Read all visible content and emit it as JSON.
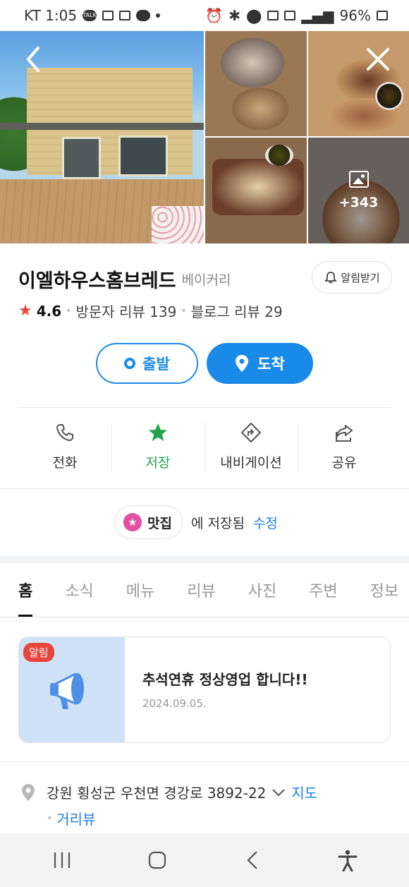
{
  "status_bar": {
    "carrier_time": "KT 1:05",
    "talk_badge": "TALK",
    "battery": "96%",
    "icons": [
      "talk-icon",
      "notification-icon",
      "photo-icon",
      "call-icon",
      "alarm-icon",
      "bluetooth-icon",
      "location-icon",
      "hd-icon",
      "5g-icon",
      "signal-icon",
      "battery-icon"
    ]
  },
  "gallery": {
    "more_count": "+343"
  },
  "place": {
    "name": "이엘하우스홈브레드",
    "category": "베이커리",
    "alert_label": "알림받기",
    "rating": "4.6",
    "visitor_reviews": "방문자 리뷰 139",
    "blog_reviews": "블로그 리뷰 29"
  },
  "route": {
    "depart_label": "출발",
    "arrive_label": "도착"
  },
  "actions": [
    {
      "label": "전화",
      "icon": "phone-icon"
    },
    {
      "label": "저장",
      "icon": "star-icon",
      "active": true
    },
    {
      "label": "내비게이션",
      "icon": "navigation-icon"
    },
    {
      "label": "공유",
      "icon": "share-icon"
    }
  ],
  "saved": {
    "folder": "맛집",
    "saved_text": "에 저장됨",
    "edit_label": "수정"
  },
  "tabs": [
    "홈",
    "소식",
    "메뉴",
    "리뷰",
    "사진",
    "주변",
    "정보"
  ],
  "notice": {
    "badge": "알림",
    "title": "추석연휴 정상영업 합니다!!",
    "date": "2024.09.05."
  },
  "address": {
    "text": "강원 횡성군 우천면 경강로 3892-22",
    "map_link": "지도",
    "street_view_link": "거리뷰"
  },
  "colors": {
    "primary_blue": "#1a8ae8",
    "save_green": "#22a34a",
    "rating_red": "#e8453c",
    "folder_pink": "#e04fa0"
  }
}
